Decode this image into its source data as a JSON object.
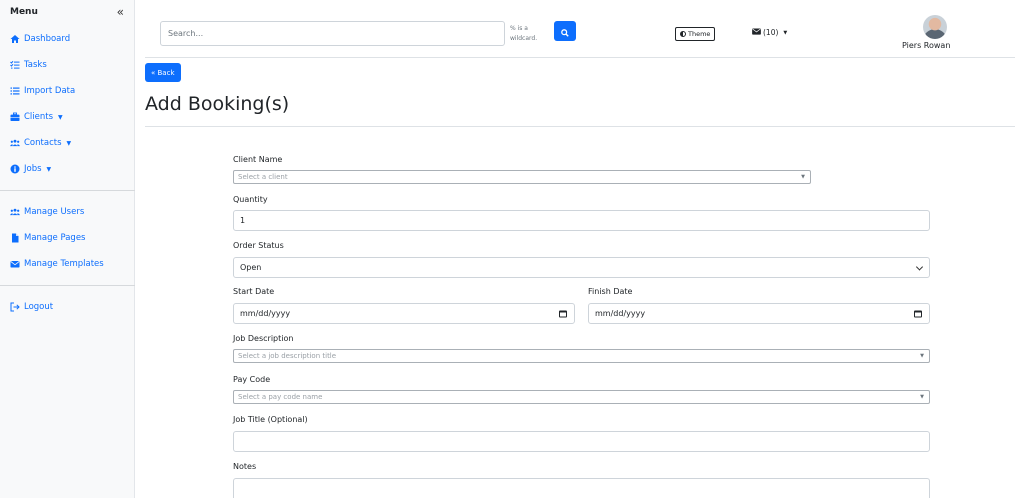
{
  "sidebar": {
    "title": "Menu",
    "collapse_glyph": "«",
    "items": [
      {
        "label": "Dashboard",
        "icon": "home-icon"
      },
      {
        "label": "Tasks",
        "icon": "list-check-icon"
      },
      {
        "label": "Import Data",
        "icon": "list-icon"
      },
      {
        "label": "Clients",
        "icon": "briefcase-icon",
        "dropdown": true
      },
      {
        "label": "Contacts",
        "icon": "users-icon",
        "dropdown": true
      },
      {
        "label": "Jobs",
        "icon": "info-circle-icon",
        "dropdown": true
      },
      {
        "label": "Manage Users",
        "icon": "users-icon"
      },
      {
        "label": "Manage Pages",
        "icon": "file-icon"
      },
      {
        "label": "Manage Templates",
        "icon": "envelope-icon"
      },
      {
        "label": "Logout",
        "icon": "sign-out-icon"
      }
    ]
  },
  "header": {
    "search_placeholder": "Search...",
    "wildcard_hint": "% is a wildcard.",
    "theme_label": "Theme",
    "mail_count": "(10)",
    "user_name": "Piers Rowan"
  },
  "main": {
    "back_label": "« Back",
    "title": "Add Booking(s)"
  },
  "form": {
    "client_name_label": "Client Name",
    "client_name_placeholder": "Select a client",
    "quantity_label": "Quantity",
    "quantity_value": "1",
    "order_status_label": "Order Status",
    "order_status_value": "Open",
    "start_date_label": "Start Date",
    "start_date_value": "mm/dd/yyyy",
    "finish_date_label": "Finish Date",
    "finish_date_value": "mm/dd/yyyy",
    "job_description_label": "Job Description",
    "job_description_placeholder": "Select a job description title",
    "pay_code_label": "Pay Code",
    "pay_code_placeholder": "Select a pay code name",
    "job_title_label": "Job Title (Optional)",
    "notes_label": "Notes"
  },
  "colors": {
    "primary": "#0d6efd",
    "sidebar_bg": "#f8f9fa",
    "text": "#212529"
  }
}
